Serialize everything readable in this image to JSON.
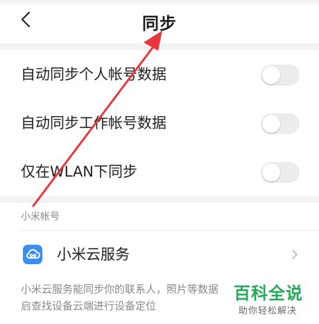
{
  "header": {
    "title": "同步",
    "back_icon": "chevron-left-icon"
  },
  "sync_settings": [
    {
      "label": "自动同步个人帐号数据",
      "enabled": false
    },
    {
      "label": "自动同步工作帐号数据",
      "enabled": false
    },
    {
      "label": "仅在WLAN下同步",
      "enabled": false
    }
  ],
  "account_section": {
    "title": "小米帐号",
    "cloud_service": {
      "label": "小米云服务",
      "icon": "cloud-icon",
      "chevron_icon": "chevron-right-icon"
    },
    "description_lines": [
      "小米云服务能同步你的联系人，照片等数据",
      "启查找设备云端进行设备定位"
    ]
  },
  "watermark": {
    "title": "百科全说",
    "subtitle": "助你轻松解决"
  },
  "colors": {
    "background": "#ffffff",
    "section_gap": "#f3f3f3",
    "toggle_off_track": "#ececec",
    "secondary_text": "#8a8a8a",
    "cloud_icon_blue": "#3a8ef6",
    "annotation_arrow_red": "#e8363b",
    "watermark_green": "#25a85a"
  }
}
